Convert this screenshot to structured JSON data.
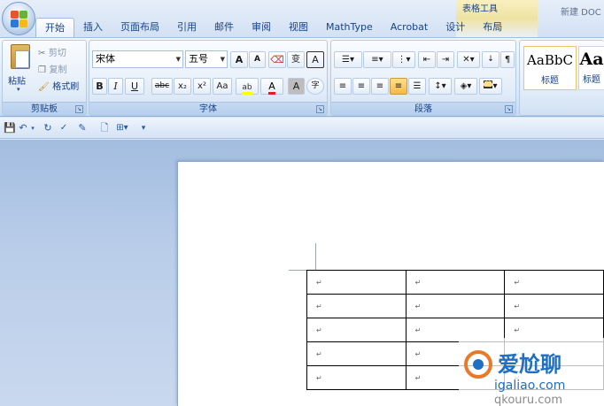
{
  "title_bar": {
    "contextual_tab_group": "表格工具",
    "document_title": "新建 DOC"
  },
  "tabs": [
    {
      "label": "开始",
      "active": true
    },
    {
      "label": "插入",
      "active": false
    },
    {
      "label": "页面布局",
      "active": false
    },
    {
      "label": "引用",
      "active": false
    },
    {
      "label": "邮件",
      "active": false
    },
    {
      "label": "审阅",
      "active": false
    },
    {
      "label": "视图",
      "active": false
    },
    {
      "label": "MathType",
      "active": false
    },
    {
      "label": "Acrobat",
      "active": false
    },
    {
      "label": "设计",
      "active": false
    },
    {
      "label": "布局",
      "active": false
    }
  ],
  "ribbon": {
    "clipboard": {
      "label": "剪贴板",
      "paste": "粘贴",
      "cut": "剪切",
      "copy": "复制",
      "format_painter": "格式刷"
    },
    "font": {
      "label": "字体",
      "font_name": "宋体",
      "font_size": "五号",
      "grow": "A",
      "shrink": "A",
      "phonetic": "变",
      "char_border": "A",
      "bold": "B",
      "italic": "I",
      "underline": "U",
      "strikethrough": "abc",
      "subscript": "x₂",
      "superscript": "x²",
      "change_case": "Aa",
      "font_color": "A",
      "char_shading": "A",
      "enclose": "字"
    },
    "paragraph": {
      "label": "段落"
    },
    "styles": {
      "items": [
        {
          "sample": "AaBbC",
          "name": "标题"
        },
        {
          "sample": "Aa",
          "name": "标题"
        }
      ]
    }
  },
  "colors": {
    "accent": "#15428b",
    "ribbon_bg": "#dbe8f7",
    "workspace_bg": "#b9cde9",
    "context_band": "#efe3a3"
  },
  "table": {
    "rows": 5,
    "cols": 3,
    "cell_mark": "↵"
  },
  "watermark": {
    "text": "爱尬聊",
    "url": "igaliao.com",
    "secondary": "qkouru.com"
  }
}
